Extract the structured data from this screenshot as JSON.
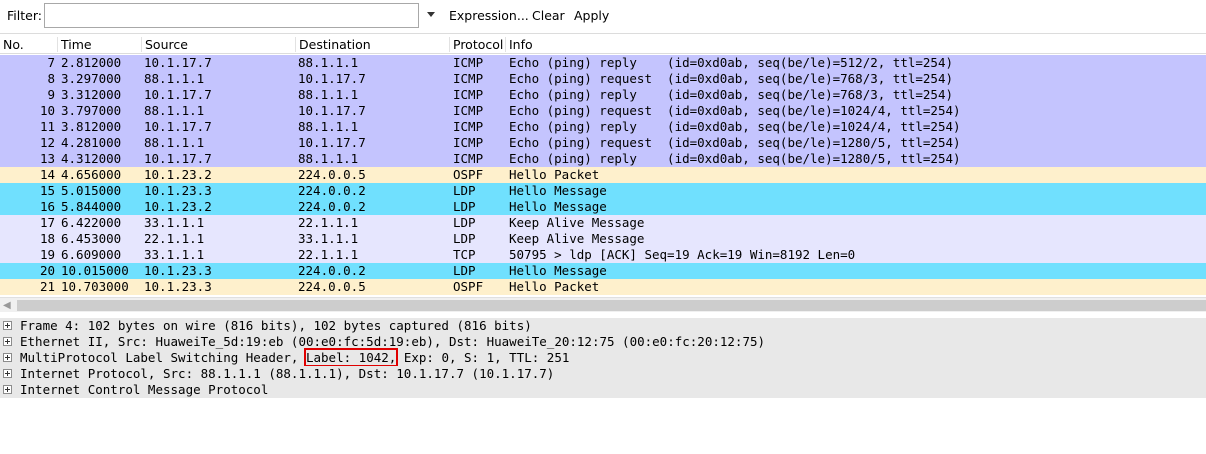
{
  "toolbar": {
    "filter_label": "Filter:",
    "filter_value": "",
    "expression_label": "Expression...",
    "clear_label": "Clear",
    "apply_label": "Apply"
  },
  "columns": [
    "No.",
    "Time",
    "Source",
    "Destination",
    "Protocol",
    "Info"
  ],
  "row_colors": {
    "icmp": "#c4c4fe",
    "ospf": "#fef0cc",
    "ldp": "#70e0fe",
    "ldp_keepalive": "#e6e6fe",
    "tcp": "#e6e6fe"
  },
  "packets": [
    {
      "no": "7",
      "time": "2.812000",
      "source": "10.1.17.7",
      "destination": "88.1.1.1",
      "protocol": "ICMP",
      "info": "Echo (ping) reply    (id=0xd0ab, seq(be/le)=512/2, ttl=254)",
      "color": "icmp"
    },
    {
      "no": "8",
      "time": "3.297000",
      "source": "88.1.1.1",
      "destination": "10.1.17.7",
      "protocol": "ICMP",
      "info": "Echo (ping) request  (id=0xd0ab, seq(be/le)=768/3, ttl=254)",
      "color": "icmp"
    },
    {
      "no": "9",
      "time": "3.312000",
      "source": "10.1.17.7",
      "destination": "88.1.1.1",
      "protocol": "ICMP",
      "info": "Echo (ping) reply    (id=0xd0ab, seq(be/le)=768/3, ttl=254)",
      "color": "icmp"
    },
    {
      "no": "10",
      "time": "3.797000",
      "source": "88.1.1.1",
      "destination": "10.1.17.7",
      "protocol": "ICMP",
      "info": "Echo (ping) request  (id=0xd0ab, seq(be/le)=1024/4, ttl=254)",
      "color": "icmp"
    },
    {
      "no": "11",
      "time": "3.812000",
      "source": "10.1.17.7",
      "destination": "88.1.1.1",
      "protocol": "ICMP",
      "info": "Echo (ping) reply    (id=0xd0ab, seq(be/le)=1024/4, ttl=254)",
      "color": "icmp"
    },
    {
      "no": "12",
      "time": "4.281000",
      "source": "88.1.1.1",
      "destination": "10.1.17.7",
      "protocol": "ICMP",
      "info": "Echo (ping) request  (id=0xd0ab, seq(be/le)=1280/5, ttl=254)",
      "color": "icmp"
    },
    {
      "no": "13",
      "time": "4.312000",
      "source": "10.1.17.7",
      "destination": "88.1.1.1",
      "protocol": "ICMP",
      "info": "Echo (ping) reply    (id=0xd0ab, seq(be/le)=1280/5, ttl=254)",
      "color": "icmp"
    },
    {
      "no": "14",
      "time": "4.656000",
      "source": "10.1.23.2",
      "destination": "224.0.0.5",
      "protocol": "OSPF",
      "info": "Hello Packet",
      "color": "ospf"
    },
    {
      "no": "15",
      "time": "5.015000",
      "source": "10.1.23.3",
      "destination": "224.0.0.2",
      "protocol": "LDP",
      "info": "Hello Message",
      "color": "ldp"
    },
    {
      "no": "16",
      "time": "5.844000",
      "source": "10.1.23.2",
      "destination": "224.0.0.2",
      "protocol": "LDP",
      "info": "Hello Message",
      "color": "ldp"
    },
    {
      "no": "17",
      "time": "6.422000",
      "source": "33.1.1.1",
      "destination": "22.1.1.1",
      "protocol": "LDP",
      "info": "Keep Alive Message",
      "color": "ldp_keepalive"
    },
    {
      "no": "18",
      "time": "6.453000",
      "source": "22.1.1.1",
      "destination": "33.1.1.1",
      "protocol": "LDP",
      "info": "Keep Alive Message",
      "color": "ldp_keepalive"
    },
    {
      "no": "19",
      "time": "6.609000",
      "source": "33.1.1.1",
      "destination": "22.1.1.1",
      "protocol": "TCP",
      "info": "50795 > ldp [ACK] Seq=19 Ack=19 Win=8192 Len=0",
      "color": "tcp"
    },
    {
      "no": "20",
      "time": "10.015000",
      "source": "10.1.23.3",
      "destination": "224.0.0.2",
      "protocol": "LDP",
      "info": "Hello Message",
      "color": "ldp"
    },
    {
      "no": "21",
      "time": "10.703000",
      "source": "10.1.23.3",
      "destination": "224.0.0.5",
      "protocol": "OSPF",
      "info": "Hello Packet",
      "color": "ospf"
    }
  ],
  "details": [
    {
      "text": "Frame 4: 102 bytes on wire (816 bits), 102 bytes captured (816 bits)"
    },
    {
      "text": "Ethernet II, Src: HuaweiTe_5d:19:eb (00:e0:fc:5d:19:eb), Dst: HuaweiTe_20:12:75 (00:e0:fc:20:12:75)"
    },
    {
      "text_before": "MultiProtocol Label Switching Header, ",
      "highlight": "Label: 1042,",
      "text_after": " Exp: 0, S: 1, TTL: 251"
    },
    {
      "text": "Internet Protocol, Src: 88.1.1.1 (88.1.1.1), Dst: 10.1.17.7 (10.1.17.7)"
    },
    {
      "text": "Internet Control Message Protocol"
    }
  ]
}
